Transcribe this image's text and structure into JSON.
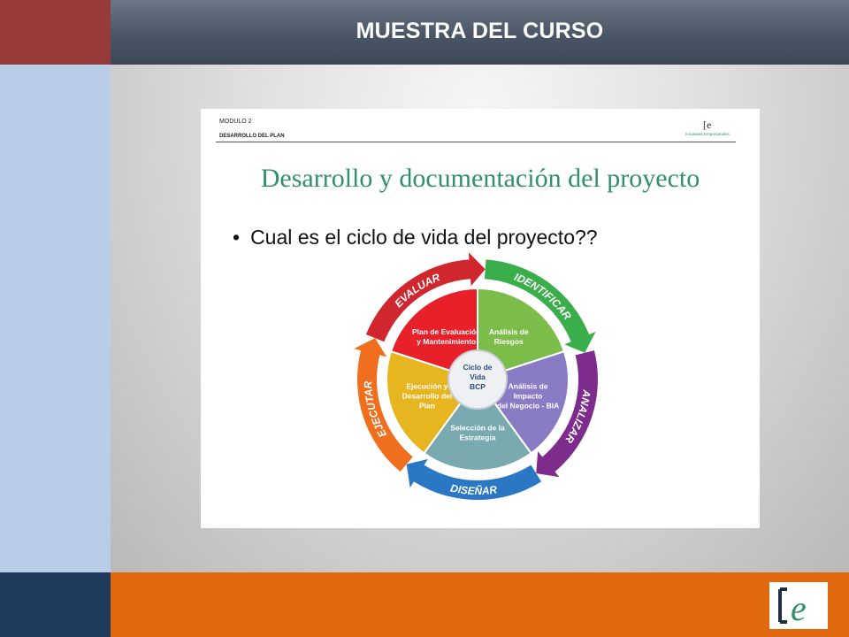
{
  "header": {
    "title": "MUESTRA DEL CURSO"
  },
  "slide": {
    "module_label": "MODULO 2",
    "section_label": "DESARROLLO DEL PLAN",
    "title": "Desarrollo y documentación del proyecto",
    "bullet": "Cual es el ciclo de vida del proyecto??",
    "logo_mark": "[e",
    "logo_caption": "Iniciativas Empresariales"
  },
  "diagram": {
    "center": [
      "Ciclo de",
      "Vida",
      "BCP"
    ],
    "segments": [
      {
        "lines": [
          "Plan de Evaluación",
          "y Mantenimiento"
        ],
        "color": "#e8202a"
      },
      {
        "lines": [
          "Análisis de",
          "Riesgos"
        ],
        "color": "#7cbc4a"
      },
      {
        "lines": [
          "Análisis de",
          "Impacto",
          "del Negocio - BIA"
        ],
        "color": "#8a7cc4"
      },
      {
        "lines": [
          "Selección de la",
          "Estrategia"
        ],
        "color": "#78aab0"
      },
      {
        "lines": [
          "Ejecución y",
          "Desarrollo del",
          "Plan"
        ],
        "color": "#e7b520"
      }
    ],
    "ring": [
      {
        "label": "EVALUAR",
        "color": "#d0262e"
      },
      {
        "label": "IDENTIFICAR",
        "color": "#3aae4a"
      },
      {
        "label": "ANALIZAR",
        "color": "#7d2b8c"
      },
      {
        "label": "DISEÑAR",
        "color": "#2a77c4"
      },
      {
        "label": "EJECUTAR",
        "color": "#ef6f1f"
      }
    ]
  },
  "footer_logo": {
    "mark": "[e"
  }
}
